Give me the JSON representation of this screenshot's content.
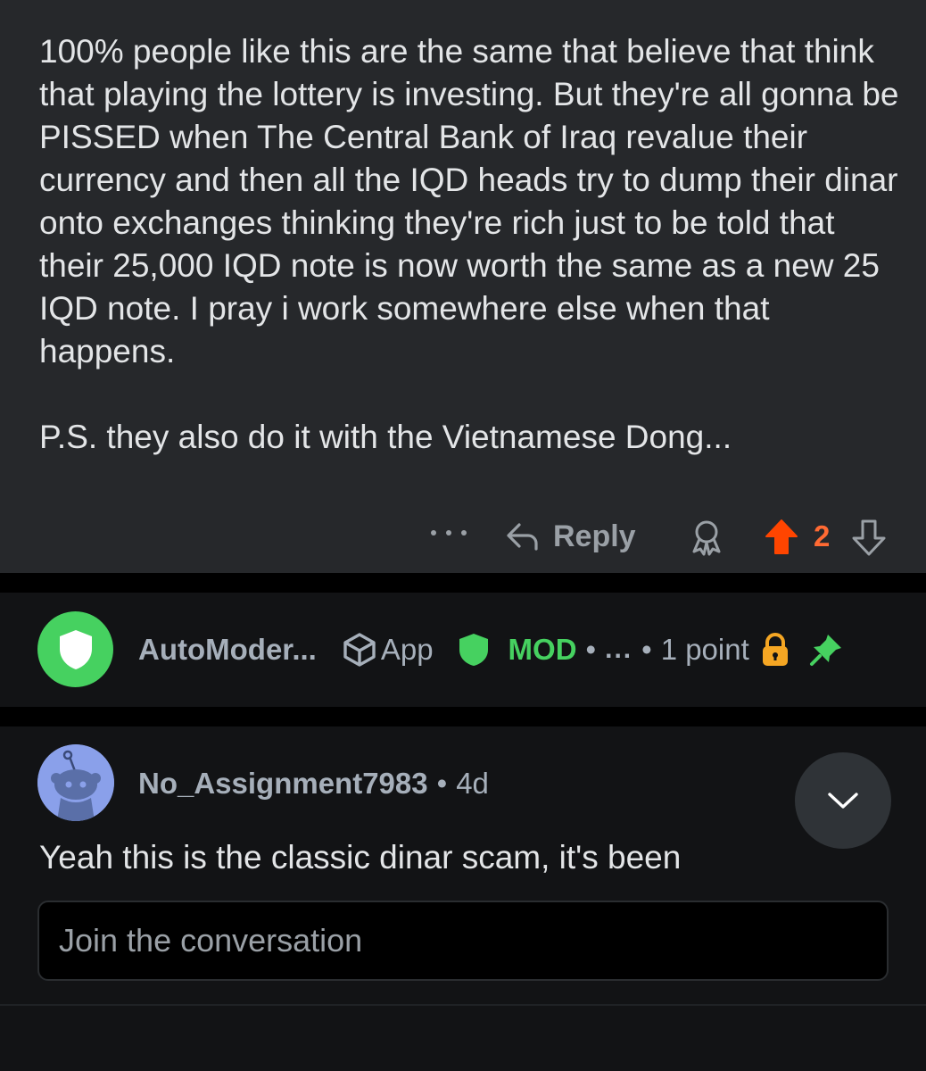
{
  "comment": {
    "body": "100% people like this are the same that believe that think that playing the lottery is investing. But they're all gonna be PISSED when The Central Bank of Iraq revalue their currency and then all the IQD heads try to dump their dinar onto exchanges thinking they're rich just to be told that their 25,000 IQD note is now worth the same as a new 25 IQD note. I pray i work somewhere else when that happens.\n\nP.S. they also do it with the Vietnamese Dong...",
    "reply_label": "Reply",
    "score": "2",
    "colors": {
      "upvote": "#ff4500",
      "score": "#ff6a33"
    }
  },
  "automod": {
    "username": "AutoModer...",
    "app_label": "App",
    "mod_label": "MOD",
    "sep": "•",
    "ellipsis": "...",
    "points": "1 point",
    "colors": {
      "avatar": "#46d160",
      "mod": "#46d160",
      "lock": "#f5a623",
      "pin": "#46d160"
    }
  },
  "reply": {
    "username": "No_Assignment7983",
    "sep": "•",
    "age": "4d",
    "text": "Yeah this is the classic dinar scam, it's been",
    "colors": {
      "avatar": "#8aa0ea"
    }
  },
  "composer": {
    "placeholder": "Join the conversation"
  },
  "icons": {
    "more": "more-horizontal-icon",
    "reply": "reply-arrow-icon",
    "award": "award-icon",
    "upvote": "upvote-arrow-icon",
    "downvote": "downvote-arrow-icon",
    "automod_avatar": "shield-icon",
    "app": "cube-icon",
    "mod": "shield-icon",
    "lock": "lock-icon",
    "pin": "pin-icon",
    "collapse": "chevron-down-icon"
  }
}
